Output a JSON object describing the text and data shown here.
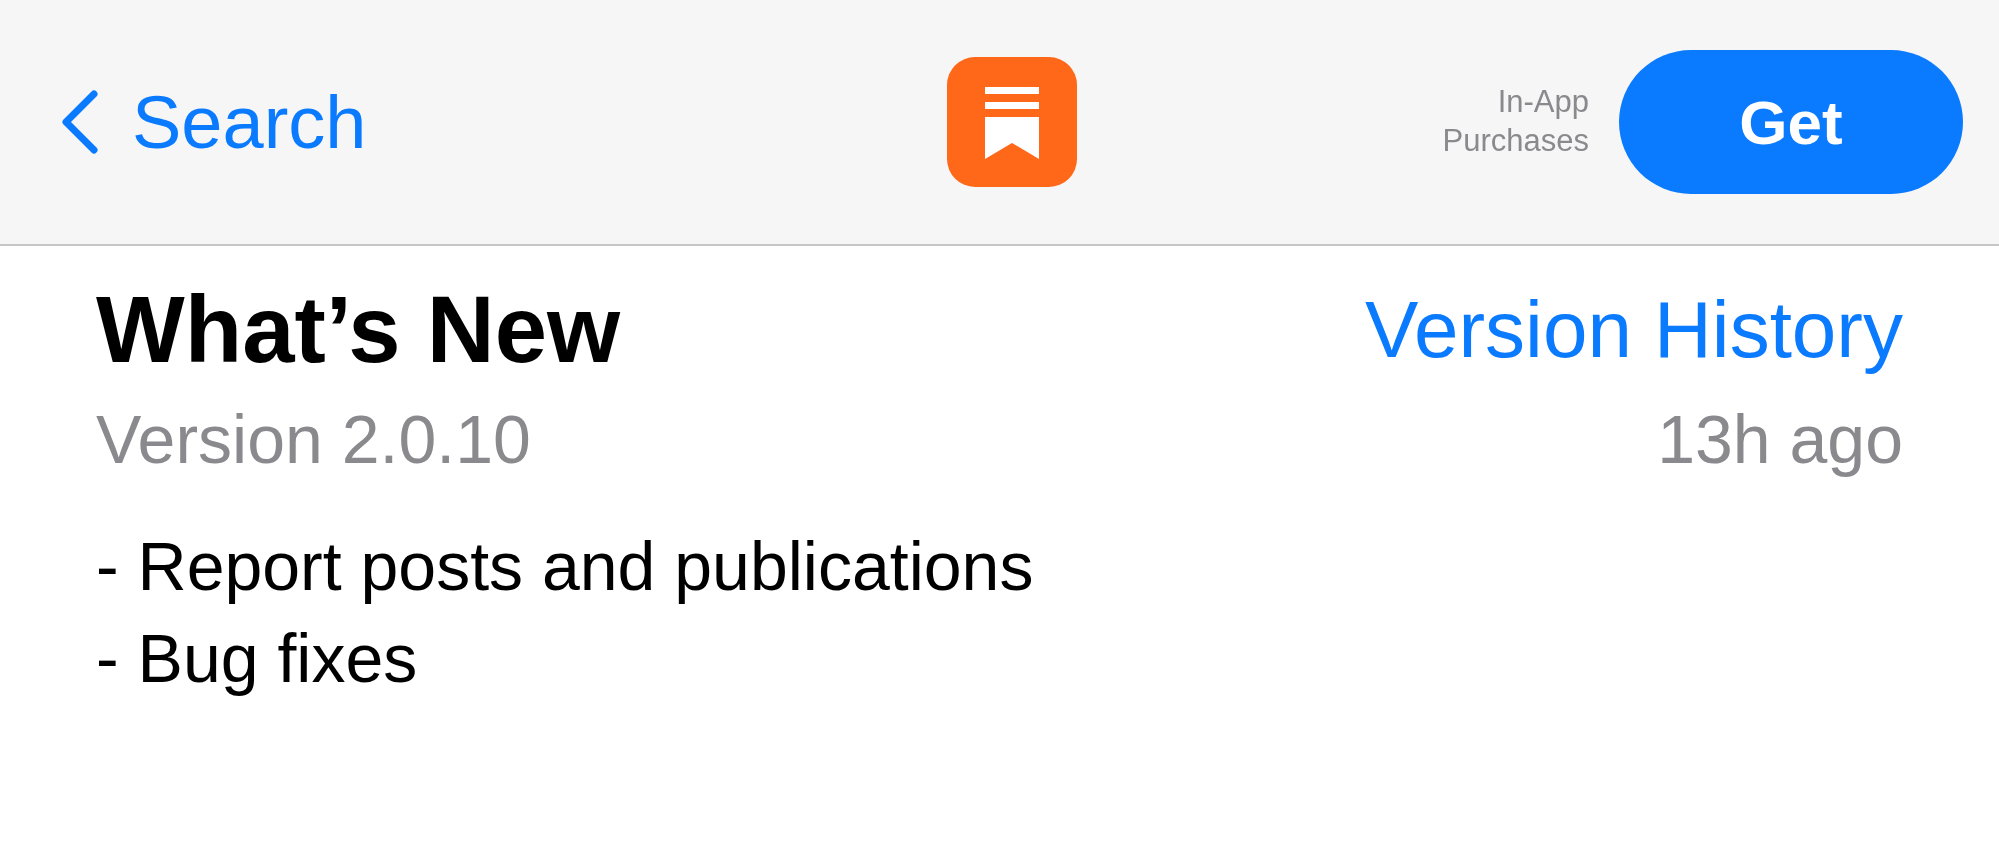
{
  "nav": {
    "back_label": "Search",
    "in_app_note": "In-App Purchases",
    "get_button": "Get"
  },
  "whats_new": {
    "title": "What’s New",
    "link": "Version History",
    "version": "Version 2.0.10",
    "age": "13h ago",
    "notes": [
      "- Report posts and publications",
      "- Bug fixes"
    ]
  }
}
